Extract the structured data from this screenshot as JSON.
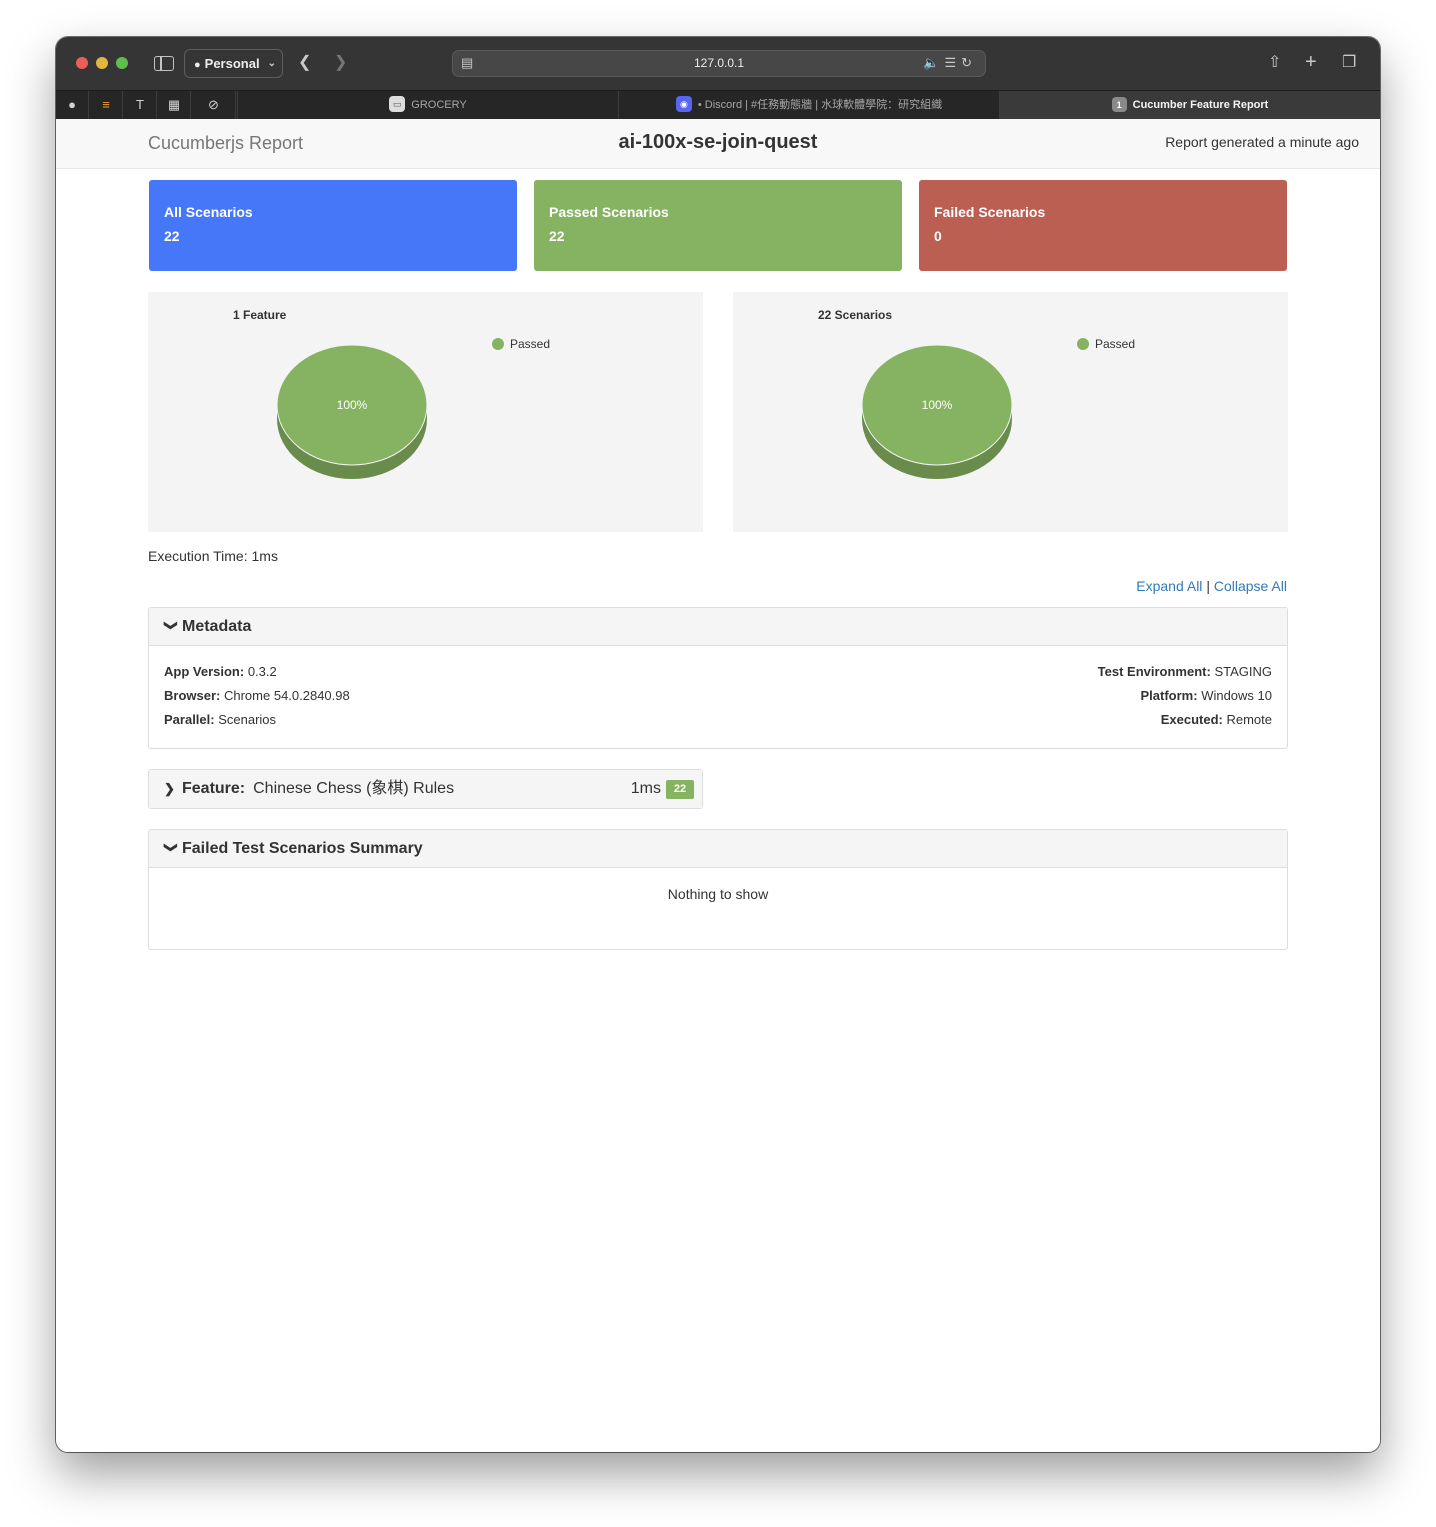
{
  "browser": {
    "profile": "Personal",
    "url": "127.0.0.1",
    "tabs": [
      {
        "title": "GROCERY",
        "favicon_text": "▭"
      },
      {
        "title": "• Discord | #任務動態牆 | 水球軟體學院：研究組織",
        "favicon_text": "◉"
      },
      {
        "title": "Cucumber Feature Report",
        "favicon_text": "1"
      }
    ]
  },
  "header": {
    "brand": "Cucumberjs Report",
    "title": "ai-100x-se-join-quest",
    "generated": "Report generated a minute ago"
  },
  "summary": {
    "all": {
      "label": "All Scenarios",
      "value": "22",
      "color": "#4577f8"
    },
    "passed": {
      "label": "Passed Scenarios",
      "value": "22",
      "color": "#86b362"
    },
    "failed": {
      "label": "Failed Scenarios",
      "value": "0",
      "color": "#bb5f52"
    }
  },
  "chart_data": [
    {
      "type": "pie",
      "title": "1 Feature",
      "categories": [
        "Passed"
      ],
      "values": [
        1
      ],
      "labels": [
        "100%"
      ],
      "legend": "top-right",
      "colors": [
        "#86b362"
      ]
    },
    {
      "type": "pie",
      "title": "22 Scenarios",
      "categories": [
        "Passed"
      ],
      "values": [
        22
      ],
      "labels": [
        "100%"
      ],
      "legend": "top-right",
      "colors": [
        "#86b362"
      ]
    }
  ],
  "execution_time": "Execution Time: 1ms",
  "links": {
    "expand_all": "Expand All",
    "separator": "|",
    "collapse_all": "Collapse All"
  },
  "metadata": {
    "title": "Metadata",
    "app_version": {
      "label": "App Version:",
      "value": "0.3.2"
    },
    "browser": {
      "label": "Browser:",
      "value": "Chrome 54.0.2840.98"
    },
    "parallel": {
      "label": "Parallel:",
      "value": "Scenarios"
    },
    "test_environment": {
      "label": "Test Environment:",
      "value": "STAGING"
    },
    "platform": {
      "label": "Platform:",
      "value": "Windows 10"
    },
    "executed": {
      "label": "Executed:",
      "value": "Remote"
    }
  },
  "feature": {
    "keyword": "Feature:",
    "name": "Chinese Chess (象棋) Rules",
    "duration": "1ms",
    "scenario_count": "22"
  },
  "failed_summary": {
    "title": "Failed Test Scenarios Summary",
    "empty_text": "Nothing to show"
  }
}
